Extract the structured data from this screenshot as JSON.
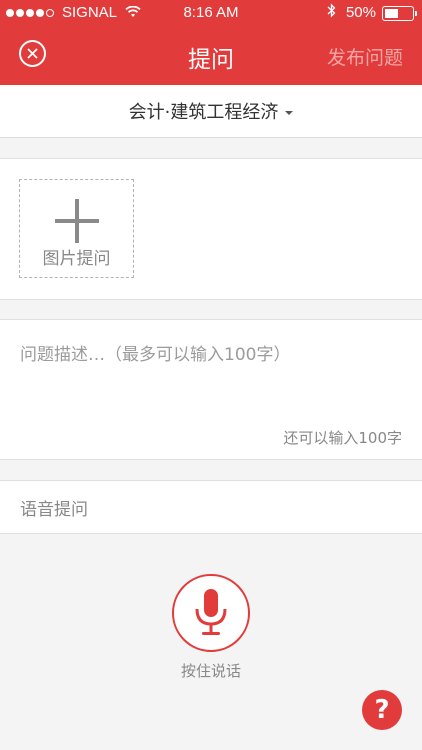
{
  "status_bar": {
    "carrier": "SIGNAL",
    "time": "8:16 AM",
    "battery": "50%",
    "battery_level": 0.5,
    "signal_dots_filled": 4,
    "icons": [
      "wifi-icon",
      "bluetooth-icon",
      "battery-icon"
    ]
  },
  "navbar": {
    "title": "提问",
    "publish_label": "发布问题",
    "close_icon": "close-icon"
  },
  "subject": {
    "label": "会计·建筑工程经济",
    "icon": "caret-down-icon"
  },
  "photo_question": {
    "label": "图片提问",
    "icon": "plus-icon"
  },
  "description": {
    "placeholder": "问题描述…（最多可以输入100字）",
    "value": "",
    "remaining_text": "还可以输入100字"
  },
  "voice": {
    "section_title": "语音提问",
    "hold_label": "按住说话",
    "icon": "microphone-icon"
  },
  "help": {
    "label": "?"
  },
  "colors": {
    "accent": "#e23b3b",
    "background": "#f4f4f4",
    "publish_disabled": "#f4a5a5"
  }
}
